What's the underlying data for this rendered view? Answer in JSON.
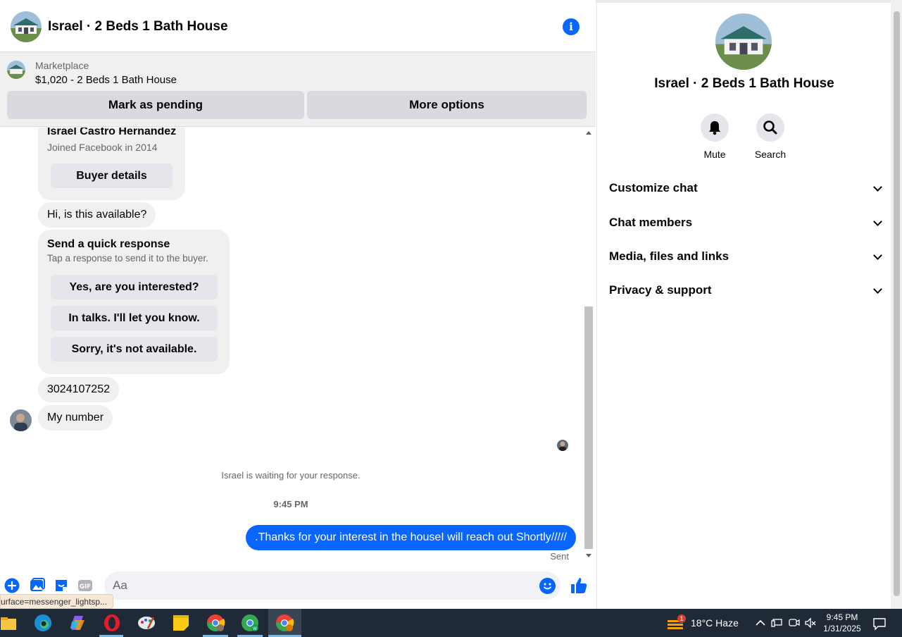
{
  "header": {
    "title": "Israel · 2 Beds 1 Bath House"
  },
  "marketplace": {
    "label": "Marketplace",
    "listing": "$1,020 - 2 Beds 1 Bath House",
    "mark_pending": "Mark as pending",
    "more_options": "More options"
  },
  "messages": {
    "buyer_name": "Israel Castro Hernandez",
    "buyer_joined": "Joined Facebook in 2014",
    "buyer_details_btn": "Buyer details",
    "msg_hi": "Hi, is this available?",
    "quick_title": "Send a quick response",
    "quick_subtitle": "Tap a response to send it to the buyer.",
    "quick_options": [
      "Yes, are you interested?",
      "In talks. I'll let you know.",
      "Sorry, it's not available."
    ],
    "msg_number": "3024107252",
    "msg_my_number": "My number",
    "waiting": "Israel is waiting for your response.",
    "time": "9:45 PM",
    "outgoing": ".Thanks for your interest in the houseI will reach out Shortly/////",
    "status": "Sent"
  },
  "composer": {
    "placeholder": "Aa",
    "tooltip": "urface=messenger_lightsp..."
  },
  "panel": {
    "title": "Israel · 2 Beds 1 Bath House",
    "mute": "Mute",
    "search": "Search",
    "sections": [
      "Customize chat",
      "Chat members",
      "Media, files and links",
      "Privacy & support"
    ]
  },
  "taskbar": {
    "weather": "18°C  Haze",
    "weather_badge": "1",
    "time": "9:45 PM",
    "date": "1/31/2025"
  },
  "colors": {
    "accent": "#0866ff",
    "bubble": "#f0f0f0",
    "taskbar": "#202a36"
  }
}
